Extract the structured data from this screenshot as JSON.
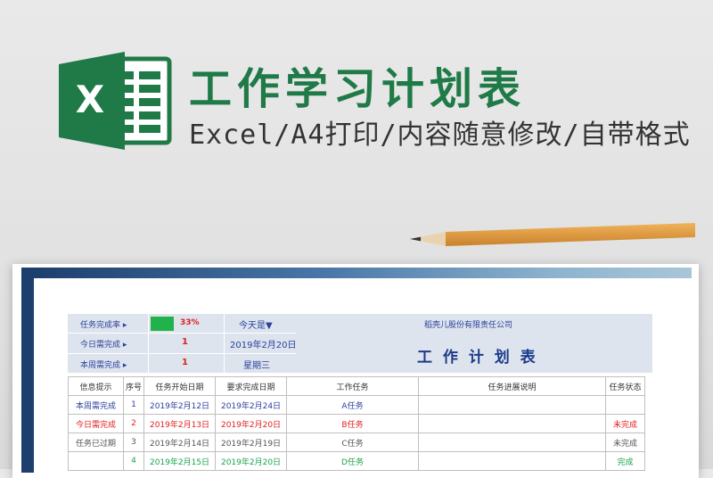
{
  "header": {
    "title": "工作学习计划表",
    "subtitle": "Excel/A4打印/内容随意修改/自带格式",
    "logo_letter": "X"
  },
  "colors": {
    "brand": "#1f7a47",
    "accent_blue": "#2b3f9c",
    "red": "#e02020",
    "green": "#1aa54a",
    "header_bg": "#dde4ee"
  },
  "info": {
    "rate_label": "任务完成率 ▸",
    "rate_value": "33%",
    "rate_fraction": 0.33,
    "today_label": "今天是▼",
    "today_due_label": "今日需完成 ▸",
    "today_due_value": "1",
    "today_date": "2019年2月20日",
    "week_due_label": "本周需完成 ▸",
    "week_due_value": "1",
    "weekday": "星期三",
    "company": "稻壳儿股份有限责任公司",
    "sheet_title": "工 作 计 划 表"
  },
  "table": {
    "headers": [
      "信息提示",
      "序号",
      "任务开始日期",
      "要求完成日期",
      "工作任务",
      "任务进展说明",
      "任务状态"
    ],
    "rows": [
      {
        "tip": "本周需完成",
        "no": "1",
        "start": "2019年2月12日",
        "due": "2019年2月24日",
        "task": "A任务",
        "note": "",
        "status": ""
      },
      {
        "tip": "今日需完成",
        "no": "2",
        "start": "2019年2月13日",
        "due": "2019年2月20日",
        "task": "B任务",
        "note": "",
        "status": "未完成"
      },
      {
        "tip": "任务已过期",
        "no": "3",
        "start": "2019年2月14日",
        "due": "2019年2月19日",
        "task": "C任务",
        "note": "",
        "status": "未完成"
      },
      {
        "tip": "",
        "no": "4",
        "start": "2019年2月15日",
        "due": "2019年2月20日",
        "task": "D任务",
        "note": "",
        "status": "完成"
      }
    ]
  }
}
